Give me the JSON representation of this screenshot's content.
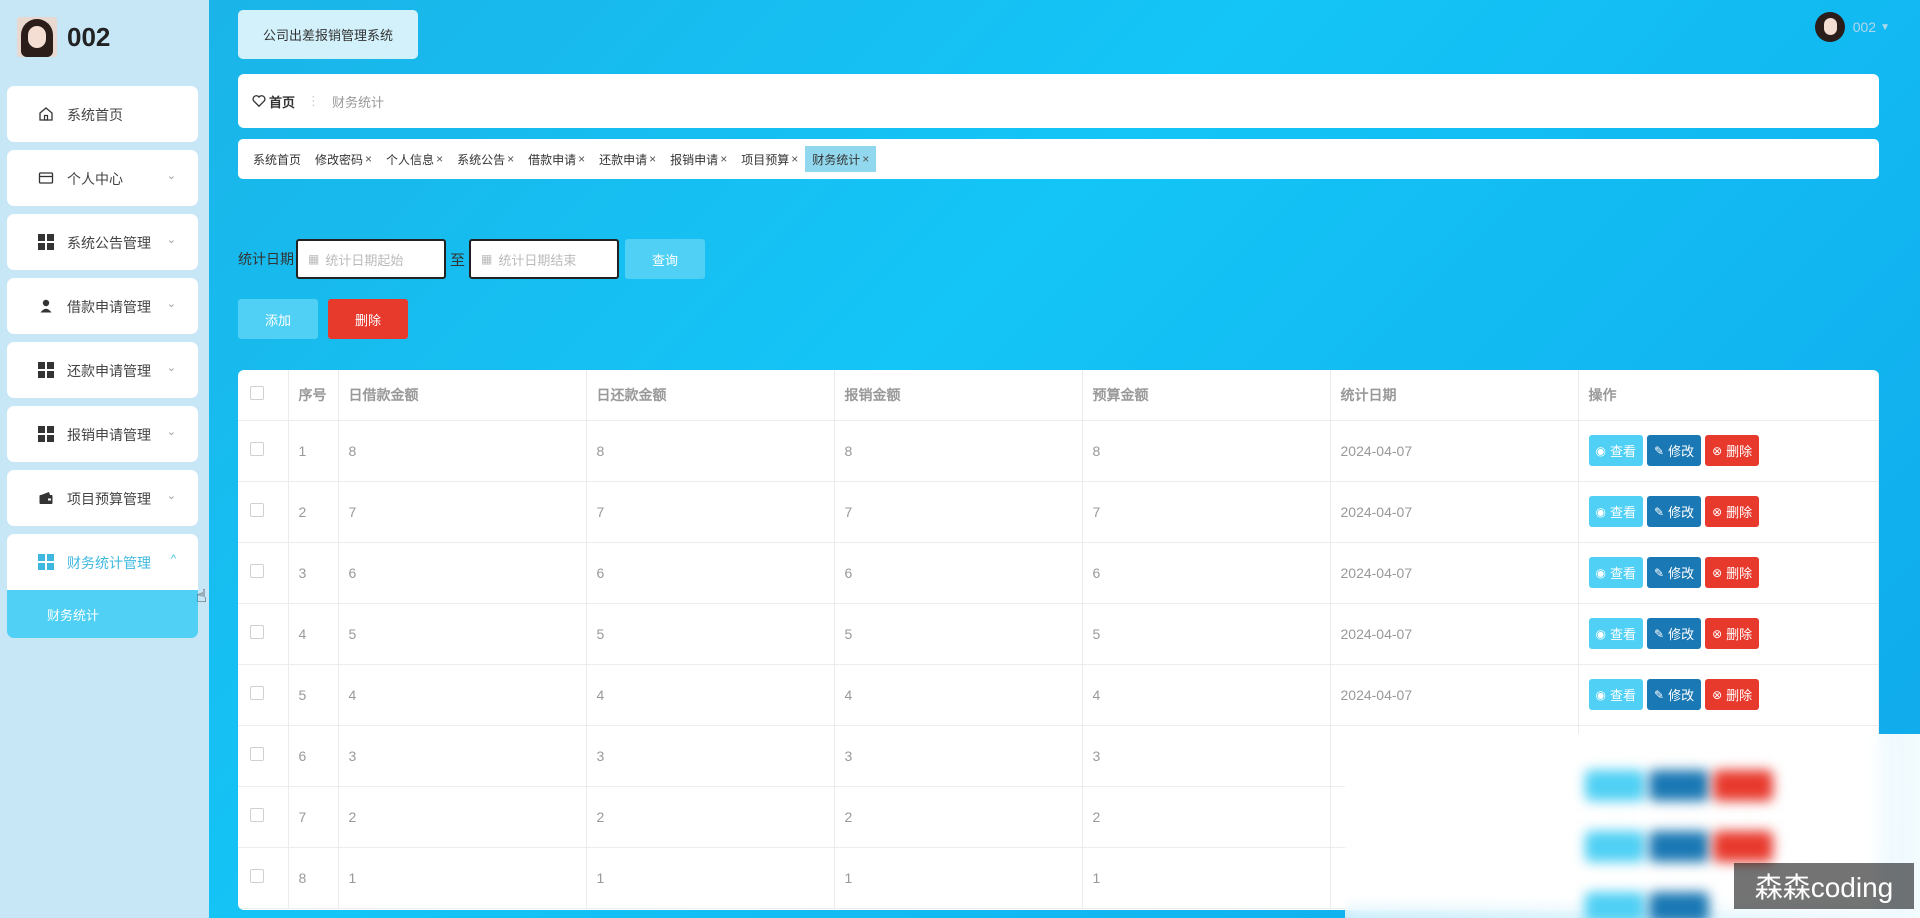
{
  "sidebar": {
    "username": "002",
    "items": [
      {
        "label": "系统首页",
        "icon": "home-icon"
      },
      {
        "label": "个人中心",
        "icon": "card-icon",
        "chevron": "⌄"
      },
      {
        "label": "系统公告管理",
        "icon": "grid-icon",
        "chevron": "⌄"
      },
      {
        "label": "借款申请管理",
        "icon": "person-icon",
        "chevron": "⌄"
      },
      {
        "label": "还款申请管理",
        "icon": "grid-icon",
        "chevron": "⌄"
      },
      {
        "label": "报销申请管理",
        "icon": "grid-icon",
        "chevron": "⌄"
      },
      {
        "label": "项目预算管理",
        "icon": "wallet-icon",
        "chevron": "⌄"
      },
      {
        "label": "财务统计管理",
        "icon": "grid-icon",
        "chevron": "^"
      }
    ],
    "submenu": {
      "label": "财务统计"
    }
  },
  "header": {
    "system_title": "公司出差报销管理系统",
    "user": "002"
  },
  "breadcrumb": {
    "home": "首页",
    "current": "财务统计"
  },
  "tags": [
    {
      "label": "系统首页",
      "closable": false
    },
    {
      "label": "修改密码",
      "closable": true
    },
    {
      "label": "个人信息",
      "closable": true
    },
    {
      "label": "系统公告",
      "closable": true
    },
    {
      "label": "借款申请",
      "closable": true
    },
    {
      "label": "还款申请",
      "closable": true
    },
    {
      "label": "报销申请",
      "closable": true
    },
    {
      "label": "项目预算",
      "closable": true
    },
    {
      "label": "财务统计",
      "closable": true,
      "active": true
    }
  ],
  "filter": {
    "label": "统计日期",
    "start_placeholder": "统计日期起始",
    "separator": "至",
    "end_placeholder": "统计日期结束",
    "query_label": "查询"
  },
  "actions": {
    "add_label": "添加",
    "delete_label": "删除"
  },
  "table": {
    "headers": [
      "序号",
      "日借款金额",
      "日还款金额",
      "报销金额",
      "预算金额",
      "统计日期",
      "操作"
    ],
    "rows": [
      {
        "no": "1",
        "borrow": "8",
        "repay": "8",
        "reimb": "8",
        "budget": "8",
        "date": "2024-04-07"
      },
      {
        "no": "2",
        "borrow": "7",
        "repay": "7",
        "reimb": "7",
        "budget": "7",
        "date": "2024-04-07"
      },
      {
        "no": "3",
        "borrow": "6",
        "repay": "6",
        "reimb": "6",
        "budget": "6",
        "date": "2024-04-07"
      },
      {
        "no": "4",
        "borrow": "5",
        "repay": "5",
        "reimb": "5",
        "budget": "5",
        "date": "2024-04-07"
      },
      {
        "no": "5",
        "borrow": "4",
        "repay": "4",
        "reimb": "4",
        "budget": "4",
        "date": "2024-04-07"
      },
      {
        "no": "6",
        "borrow": "3",
        "repay": "3",
        "reimb": "3",
        "budget": "3",
        "date": ""
      },
      {
        "no": "7",
        "borrow": "2",
        "repay": "2",
        "reimb": "2",
        "budget": "2",
        "date": ""
      },
      {
        "no": "8",
        "borrow": "1",
        "repay": "1",
        "reimb": "1",
        "budget": "1",
        "date": ""
      }
    ],
    "op_view": "查看",
    "op_edit": "修改",
    "op_delete": "删除"
  },
  "watermark": "森森coding",
  "colors": {
    "accent": "#4fd0f4",
    "danger": "#e8392d",
    "edit": "#1a78b4",
    "main_bg": "#14c5f7"
  }
}
